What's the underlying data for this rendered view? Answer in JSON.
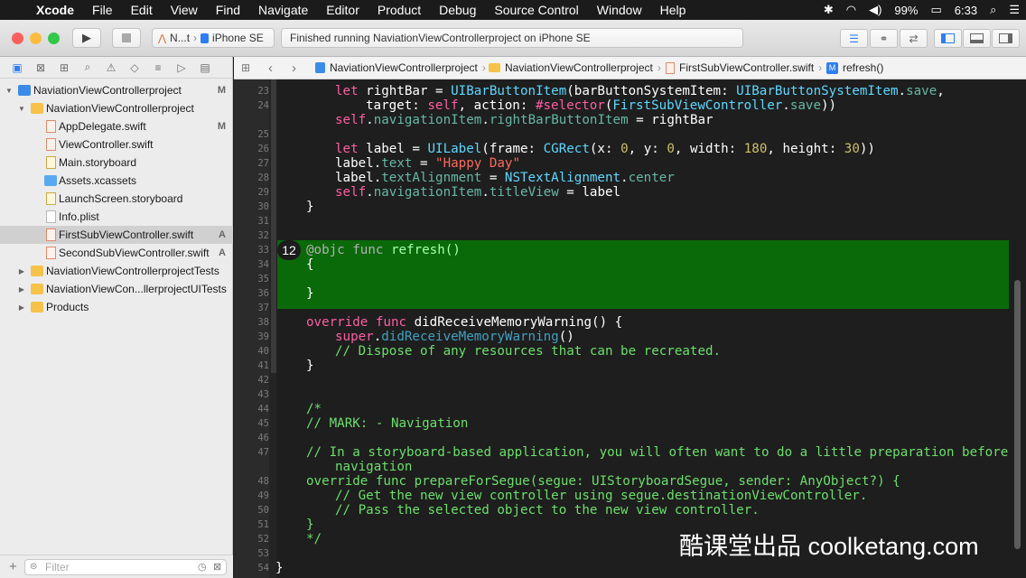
{
  "menubar": {
    "items": [
      "Xcode",
      "File",
      "Edit",
      "View",
      "Find",
      "Navigate",
      "Editor",
      "Product",
      "Debug",
      "Source Control",
      "Window",
      "Help"
    ],
    "battery": "99%",
    "time": "6:33"
  },
  "toolbar": {
    "scheme_short": "N...t",
    "device": "iPhone SE",
    "activity": "Finished running NaviationViewControllerproject on iPhone SE"
  },
  "navigator": {
    "items": [
      {
        "label": "NaviationViewControllerproject",
        "status": "M"
      },
      {
        "label": "NaviationViewControllerproject",
        "status": ""
      },
      {
        "label": "AppDelegate.swift",
        "status": "M"
      },
      {
        "label": "ViewController.swift",
        "status": ""
      },
      {
        "label": "Main.storyboard",
        "status": ""
      },
      {
        "label": "Assets.xcassets",
        "status": ""
      },
      {
        "label": "LaunchScreen.storyboard",
        "status": ""
      },
      {
        "label": "Info.plist",
        "status": ""
      },
      {
        "label": "FirstSubViewController.swift",
        "status": "A"
      },
      {
        "label": "SecondSubViewController.swift",
        "status": "A"
      },
      {
        "label": "NaviationViewControllerprojectTests",
        "status": ""
      },
      {
        "label": "NaviationViewCon...llerprojectUITests",
        "status": ""
      },
      {
        "label": "Products",
        "status": ""
      }
    ],
    "filter_placeholder": "Filter"
  },
  "jumpbar": {
    "crumbs": [
      "NaviationViewControllerproject",
      "NaviationViewControllerproject",
      "FirstSubViewController.swift",
      "refresh()"
    ]
  },
  "editor": {
    "line_numbers": [
      "23",
      "24",
      "",
      "25",
      "26",
      "27",
      "28",
      "29",
      "30",
      "31",
      "32",
      "33",
      "34",
      "35",
      "36",
      "37",
      "38",
      "39",
      "40",
      "41",
      "42",
      "43",
      "44",
      "45",
      "46",
      "47",
      "",
      "48",
      "49",
      "50",
      "51",
      "52",
      "53",
      "54"
    ],
    "badge": "12"
  },
  "watermark": "酷课堂出品 coolketang.com"
}
